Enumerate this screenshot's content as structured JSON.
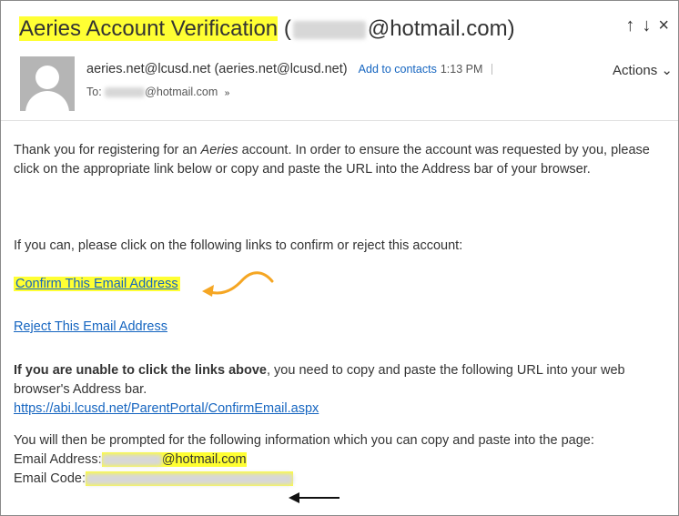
{
  "email": {
    "subject": "Aeries Account Verification",
    "subject_open": "(",
    "subject_email_domain": "@hotmail.com)",
    "sender_name": "aeries.net@lcusd.net",
    "sender_address": "(aeries.net@lcusd.net)",
    "add_contacts_label": "Add to contacts",
    "time": "1:13 PM",
    "to_label": "To:",
    "to_domain": "@hotmail.com",
    "actions_label": "Actions",
    "actions_caret": "⌄",
    "nav_up": "↑",
    "nav_down": "↓",
    "close": "×",
    "expand": "»"
  },
  "body": {
    "p1_a": "Thank you for registering for an ",
    "p1_brand": "Aeries",
    "p1_b": " account. In order to ensure the account was requested by you, please click on the appropriate link below or copy and paste the URL into the Address bar of your browser.",
    "p2": "If you can, please click on the following links to confirm or reject this account:",
    "confirm_link": "Confirm This Email Address",
    "reject_link": "Reject This Email Address",
    "p3_bold": "If you are unable to click the links above",
    "p3_rest": ", you need to copy and paste the following URL into your web browser's Address bar.",
    "url": "https://abi.lcusd.net/ParentPortal/ConfirmEmail.aspx",
    "p4": "You will then be prompted for the following information which you can copy and paste into the page:",
    "email_address_label": "Email Address:",
    "email_address_domain": "@hotmail.com",
    "email_code_label": "Email Code:"
  },
  "colors": {
    "highlight": "#ffff33",
    "link": "#1565c0",
    "annotation_arrow": "#f5a623"
  }
}
